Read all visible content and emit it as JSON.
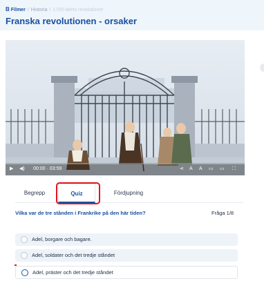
{
  "breadcrumb": {
    "brand": "Filmer",
    "items": [
      "Historia",
      "1700-talets revolutioner"
    ]
  },
  "page": {
    "title": "Franska revolutionen - orsaker"
  },
  "video": {
    "time": "00:00 · 03:59",
    "progress": 0,
    "control_icons": [
      "play-icon",
      "volume-icon",
      "share-icon",
      "text-size-decrease-icon",
      "text-size-increase-icon",
      "subtitles-icon",
      "theater-icon",
      "fullscreen-icon"
    ]
  },
  "tabs": [
    {
      "label": "Begrepp",
      "active": false
    },
    {
      "label": "Quiz",
      "active": true
    },
    {
      "label": "Fördjupning",
      "active": false
    }
  ],
  "quiz": {
    "question": "Vilka var de tre stånden i Frankrike på den här tiden?",
    "counter": "Fråga 1/8",
    "options": [
      {
        "label": "Adel, borgare och bagare.",
        "selected": false
      },
      {
        "label": "Adel, soldater och det tredje ståndet",
        "selected": false
      },
      {
        "label": "Adel, präster och det tredje ståndet",
        "selected": true
      }
    ]
  },
  "colors": {
    "accent": "#1a4fa0",
    "highlight": "#e2141b"
  }
}
